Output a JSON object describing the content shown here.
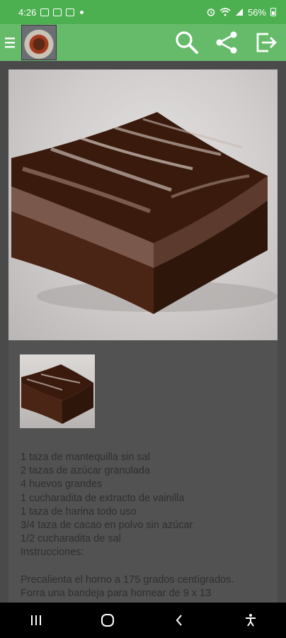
{
  "status_bar": {
    "time": "4:26",
    "battery": "56%"
  },
  "app_bar": {
    "icons": [
      "menu-icon",
      "app-logo",
      "search-icon",
      "share-icon",
      "exit-icon"
    ]
  },
  "recipe": {
    "ingredients": [
      "1 taza de mantequilla sin sal",
      "2 tazas de azúcar granulada",
      "4 huevos grandes",
      "1 cucharadita de extracto de vainilla",
      "1 taza de harina todo uso",
      "3/4 taza de cacao en polvo sin azúcar",
      "1/2 cucharadita de sal"
    ],
    "instructions_heading": "Instrucciones:",
    "instructions": [
      "Precalienta el horno a 175 grados centígrados.",
      "Forra una bandeja para hornear de 9 x 13"
    ]
  },
  "nav_bar": {
    "icons": [
      "recents-icon",
      "home-icon",
      "back-icon",
      "accessibility-icon"
    ]
  },
  "colors": {
    "status_bar": "#4caf50",
    "app_bar": "#66bb6a",
    "content_bg": "#4a4a4a",
    "card_bg": "#525252",
    "text": "#2f2f2f"
  }
}
